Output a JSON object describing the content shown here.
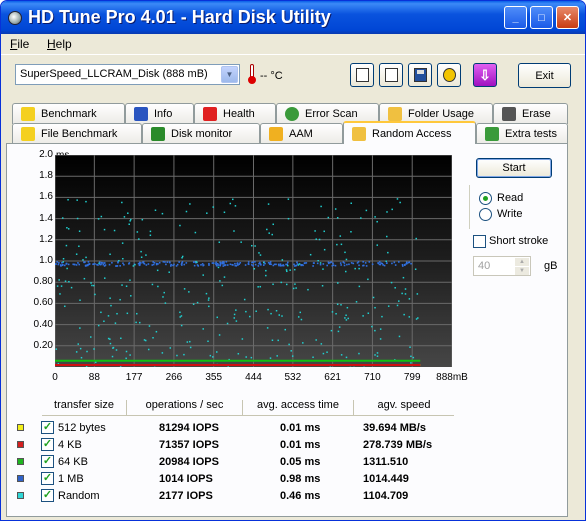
{
  "window": {
    "title": "HD Tune Pro 4.01 - Hard Disk Utility"
  },
  "menu": [
    {
      "label": "File",
      "accel": "F",
      "rest": "ile"
    },
    {
      "label": "Help",
      "accel": "H",
      "rest": "elp"
    }
  ],
  "toolbar": {
    "disk": "SuperSpeed_LLCRAM_Disk (888 mB)",
    "temperature": "-- °C",
    "exit_label": "Exit",
    "icons": [
      "copy-info-icon",
      "copy-screenshot-icon",
      "save-icon",
      "options-icon",
      "download-icon"
    ]
  },
  "tabs_top": [
    {
      "label": "Benchmark",
      "icon": "benchmark-icon"
    },
    {
      "label": "Info",
      "icon": "info-icon"
    },
    {
      "label": "Health",
      "icon": "health-icon"
    },
    {
      "label": "Error Scan",
      "icon": "error-scan-icon"
    },
    {
      "label": "Folder Usage",
      "icon": "folder-usage-icon"
    },
    {
      "label": "Erase",
      "icon": "erase-icon"
    }
  ],
  "tabs_bottom": [
    {
      "label": "File Benchmark",
      "icon": "file-benchmark-icon"
    },
    {
      "label": "Disk monitor",
      "icon": "disk-monitor-icon"
    },
    {
      "label": "AAM",
      "icon": "aam-icon"
    },
    {
      "label": "Random Access",
      "icon": "random-access-icon",
      "active": true
    },
    {
      "label": "Extra tests",
      "icon": "extra-tests-icon"
    }
  ],
  "controls": {
    "start_label": "Start",
    "read_label": "Read",
    "write_label": "Write",
    "mode": "Read",
    "short_stroke_label": "Short stroke",
    "short_stroke_checked": false,
    "short_stroke_value": "40",
    "unit_label": "gB"
  },
  "chart_data": {
    "type": "scatter",
    "ylabel": "ms",
    "ylim": [
      0,
      2.0
    ],
    "xlim": [
      0,
      888
    ],
    "y_ticks": [
      "2.0",
      "1.8",
      "1.6",
      "1.4",
      "1.2",
      "1.0",
      "0.80",
      "0.60",
      "0.40",
      "0.20"
    ],
    "y_tick_values": [
      2.0,
      1.8,
      1.6,
      1.4,
      1.2,
      1.0,
      0.8,
      0.6,
      0.4,
      0.2
    ],
    "x_ticks": [
      "0",
      "88",
      "177",
      "266",
      "355",
      "444",
      "532",
      "621",
      "710",
      "799",
      "888mB"
    ],
    "x_tick_values": [
      0,
      88,
      177,
      266,
      355,
      444,
      532,
      621,
      710,
      799,
      888
    ],
    "grid": true,
    "series": [
      {
        "name": "512 bytes",
        "color": "#e8e800",
        "typical_ms": 0.01
      },
      {
        "name": "4 KB",
        "color": "#d01010",
        "typical_ms": 0.01
      },
      {
        "name": "64 KB",
        "color": "#10c010",
        "typical_ms": 0.05
      },
      {
        "name": "1 MB",
        "color": "#3070e0",
        "typical_ms": 0.98
      },
      {
        "name": "Random",
        "color": "#20d0d0",
        "typical_ms": 0.46
      }
    ]
  },
  "results": {
    "headers": [
      "transfer size",
      "operations / sec",
      "avg. access time",
      "agv. speed"
    ],
    "rows": [
      {
        "size": "512 bytes",
        "color": "#f2ef1a",
        "ops": "81294 IOPS",
        "access": "0.01 ms",
        "speed": "39.694 MB/s"
      },
      {
        "size": "4 KB",
        "color": "#d41f1f",
        "ops": "71357 IOPS",
        "access": "0.01 ms",
        "speed": "278.739 MB/s"
      },
      {
        "size": "64 KB",
        "color": "#1fb51f",
        "ops": "20984 IOPS",
        "access": "0.05 ms",
        "speed": "1311.510"
      },
      {
        "size": "1 MB",
        "color": "#2f62c9",
        "ops": "1014 IOPS",
        "access": "0.98 ms",
        "speed": "1014.449"
      },
      {
        "size": "Random",
        "color": "#2fd6d6",
        "ops": "2177 IOPS",
        "access": "0.46 ms",
        "speed": "1104.709"
      }
    ]
  }
}
